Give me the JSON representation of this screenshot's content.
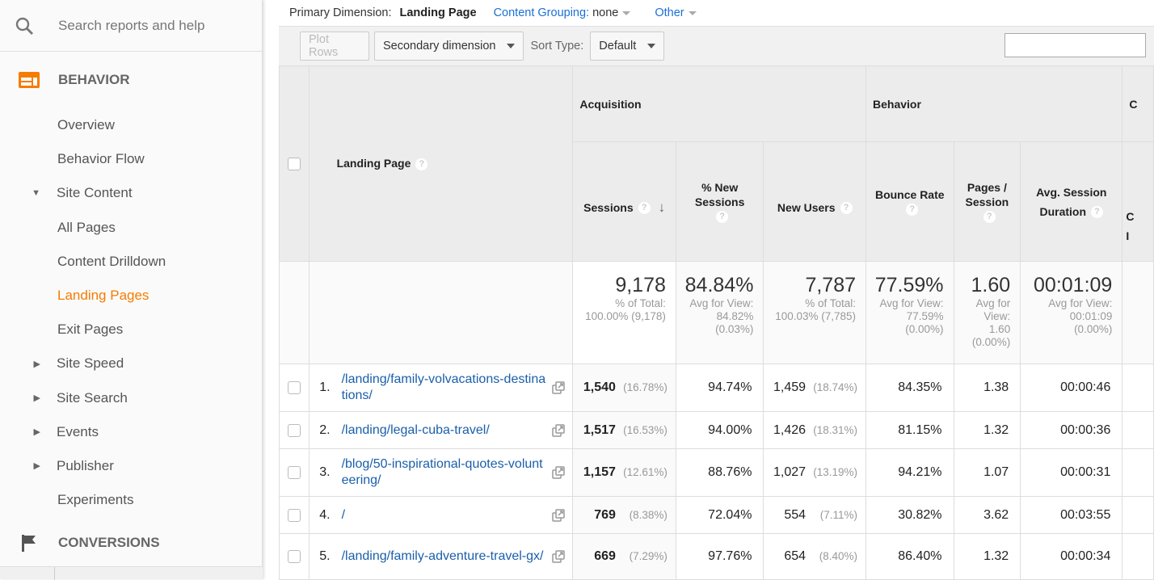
{
  "sidebar": {
    "search_placeholder": "Search reports and help",
    "section": "BEHAVIOR",
    "items": [
      {
        "label": "Overview",
        "arrow": ""
      },
      {
        "label": "Behavior Flow",
        "arrow": ""
      },
      {
        "label": "Site Content",
        "arrow": "▼"
      },
      {
        "label": "All Pages",
        "arrow": ""
      },
      {
        "label": "Content Drilldown",
        "arrow": ""
      },
      {
        "label": "Landing Pages",
        "arrow": "",
        "active": true
      },
      {
        "label": "Exit Pages",
        "arrow": ""
      },
      {
        "label": "Site Speed",
        "arrow": "▶"
      },
      {
        "label": "Site Search",
        "arrow": "▶"
      },
      {
        "label": "Events",
        "arrow": "▶"
      },
      {
        "label": "Publisher",
        "arrow": "▶"
      },
      {
        "label": "Experiments",
        "arrow": ""
      }
    ],
    "section2": "CONVERSIONS",
    "accent": "#f57c00"
  },
  "topbar": {
    "primary_label": "Primary Dimension:",
    "primary_value": "Landing Page",
    "grouping_label": "Content Grouping:",
    "grouping_value": "none",
    "other": "Other"
  },
  "toolbar": {
    "plot_rows": "Plot Rows",
    "secondary": "Secondary dimension",
    "sort_label": "Sort Type:",
    "sort_value": "Default",
    "search_value": ""
  },
  "table": {
    "groups": {
      "acquisition": "Acquisition",
      "behavior": "Behavior",
      "cut": "C"
    },
    "headers": {
      "landing": "Landing Page",
      "sessions": "Sessions",
      "new_sessions": "% New Sessions",
      "new_users": "New Users",
      "bounce": "Bounce Rate",
      "pages": "Pages / Session",
      "duration1": "Avg. Session",
      "duration2": "Duration",
      "cut1": "C",
      "cut2": "I"
    },
    "totals": {
      "sessions": {
        "value": "9,178",
        "l1": "% of Total:",
        "l2": "100.00% (9,178)"
      },
      "new_sessions": {
        "value": "84.84%",
        "l1": "Avg for View:",
        "l2": "84.82%",
        "l3": "(0.03%)"
      },
      "new_users": {
        "value": "7,787",
        "l1": "% of Total:",
        "l2": "100.03% (7,785)"
      },
      "bounce": {
        "value": "77.59%",
        "l1": "Avg for View:",
        "l2": "77.59%",
        "l3": "(0.00%)"
      },
      "pages": {
        "value": "1.60",
        "l1": "Avg for",
        "l2": "View:",
        "l3": "1.60",
        "l4": "(0.00%)"
      },
      "duration": {
        "value": "00:01:09",
        "l1": "Avg for View:",
        "l2": "00:01:09",
        "l3": "(0.00%)"
      }
    },
    "rows": [
      {
        "n": "1.",
        "page": "/landing/family-volvacations-destinations/",
        "sessions": "1,540",
        "sessions_pct": "(16.78%)",
        "new_sessions": "94.74%",
        "new_users": "1,459",
        "new_users_pct": "(18.74%)",
        "bounce": "84.35%",
        "pages": "1.38",
        "duration": "00:00:46"
      },
      {
        "n": "2.",
        "page": "/landing/legal-cuba-travel/",
        "sessions": "1,517",
        "sessions_pct": "(16.53%)",
        "new_sessions": "94.00%",
        "new_users": "1,426",
        "new_users_pct": "(18.31%)",
        "bounce": "81.15%",
        "pages": "1.32",
        "duration": "00:00:36"
      },
      {
        "n": "3.",
        "page": "/blog/50-inspirational-quotes-volunteering/",
        "sessions": "1,157",
        "sessions_pct": "(12.61%)",
        "new_sessions": "88.76%",
        "new_users": "1,027",
        "new_users_pct": "(13.19%)",
        "bounce": "94.21%",
        "pages": "1.07",
        "duration": "00:00:31"
      },
      {
        "n": "4.",
        "page": "/",
        "sessions": "769",
        "sessions_pct": "(8.38%)",
        "new_sessions": "72.04%",
        "new_users": "554",
        "new_users_pct": "(7.11%)",
        "bounce": "30.82%",
        "pages": "3.62",
        "duration": "00:03:55"
      },
      {
        "n": "5.",
        "page": "/landing/family-adventure-travel-gx/",
        "sessions": "669",
        "sessions_pct": "(7.29%)",
        "new_sessions": "97.76%",
        "new_users": "654",
        "new_users_pct": "(8.40%)",
        "bounce": "86.40%",
        "pages": "1.32",
        "duration": "00:00:34"
      }
    ]
  }
}
